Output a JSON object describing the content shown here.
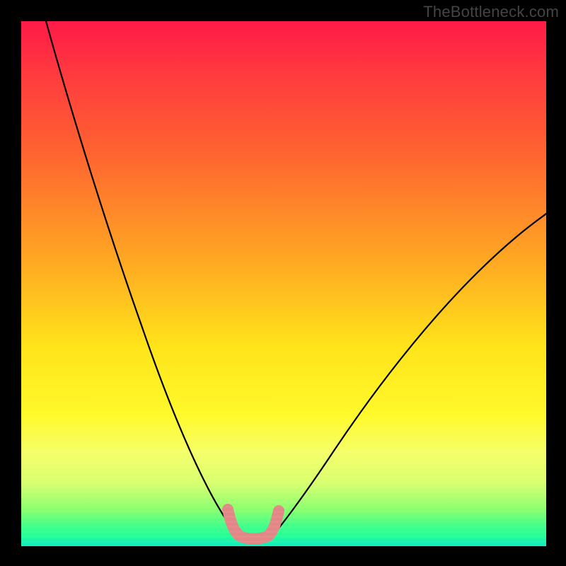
{
  "watermark": "TheBottleneck.com",
  "chart_data": {
    "type": "line",
    "title": "",
    "xlabel": "",
    "ylabel": "",
    "xlim": [
      0,
      100
    ],
    "ylim": [
      0,
      100
    ],
    "background_gradient": {
      "top": "#ff1a47",
      "middle": "#ffe41a",
      "bottom": "#0eedc1"
    },
    "series": [
      {
        "name": "left-descending-curve",
        "color": "#000000",
        "x": [
          5,
          10,
          15,
          20,
          25,
          30,
          35,
          38,
          40,
          41
        ],
        "y": [
          100,
          85,
          68,
          52,
          37,
          23,
          12,
          6,
          3,
          2
        ]
      },
      {
        "name": "right-ascending-curve",
        "color": "#000000",
        "x": [
          48,
          50,
          55,
          60,
          65,
          70,
          75,
          80,
          85,
          90,
          95,
          99
        ],
        "y": [
          2,
          4,
          9,
          15,
          22,
          30,
          38,
          46,
          53,
          58,
          62,
          64
        ]
      },
      {
        "name": "valley-marker",
        "color": "#e38686",
        "style": "thick-rounded",
        "x": [
          39.5,
          40.5,
          41.5,
          43.0,
          45.0,
          46.0,
          47.0,
          48.0,
          49.0
        ],
        "y": [
          6.0,
          3.5,
          2.0,
          1.8,
          1.8,
          2.0,
          3.0,
          5.0,
          8.0
        ]
      }
    ]
  }
}
